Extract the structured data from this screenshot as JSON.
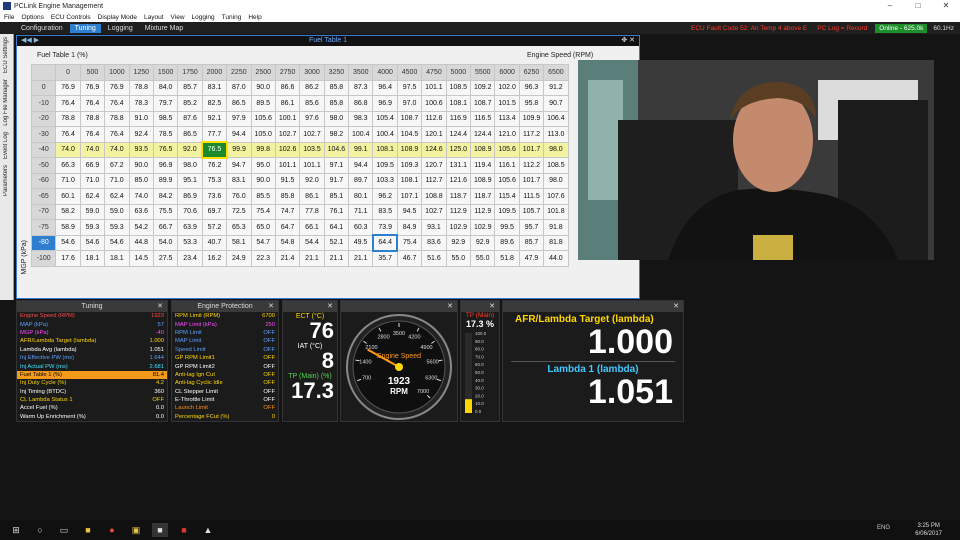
{
  "app": {
    "title": "PCLink Engine Management"
  },
  "menu": [
    "File",
    "Options",
    "ECU Controls",
    "Display Mode",
    "Layout",
    "View",
    "Logging",
    "Tuning",
    "Help"
  ],
  "tabs": [
    "Configuration",
    "Tuning",
    "Logging",
    "Mixture Map"
  ],
  "status": {
    "fault": "ECU Fault Code 52: An Temp 4 above E",
    "log": "PC Log = Record",
    "online": "Online - 625.0k",
    "hz": "60.1Hz"
  },
  "side_tabs": [
    "ECU Settings",
    "Log File Manager",
    "Event Log",
    "Parameters"
  ],
  "fuel": {
    "window_title": "Fuel Table 1",
    "label": "Fuel Table 1 (%)",
    "x_label": "Engine Speed (RPM)",
    "y_label": "MGP (kPa)",
    "rpm": [
      "0",
      "500",
      "1000",
      "1250",
      "1500",
      "1750",
      "2000",
      "2250",
      "2500",
      "2750",
      "3000",
      "3250",
      "3500",
      "4000",
      "4500",
      "4750",
      "5000",
      "5500",
      "6000",
      "6250",
      "6500"
    ],
    "rows": [
      {
        "mgp": "0",
        "v": [
          "76.9",
          "76.9",
          "76.9",
          "78.8",
          "84.0",
          "85.7",
          "83.1",
          "87.0",
          "90.0",
          "86.6",
          "86.2",
          "85.8",
          "87.3",
          "96.4",
          "97.5",
          "101.1",
          "108.5",
          "109.2",
          "102.0",
          "96.3",
          "91.2"
        ]
      },
      {
        "mgp": "-10",
        "v": [
          "76.4",
          "76.4",
          "76.4",
          "78.3",
          "79.7",
          "85.2",
          "82.5",
          "86.5",
          "89.5",
          "86.1",
          "85.6",
          "85.8",
          "86.8",
          "96.9",
          "97.0",
          "100.6",
          "108.1",
          "108.7",
          "101.5",
          "95.8",
          "90.7"
        ]
      },
      {
        "mgp": "-20",
        "v": [
          "78.8",
          "78.8",
          "78.8",
          "91.0",
          "98.5",
          "87.6",
          "92.1",
          "97.9",
          "105.6",
          "100.1",
          "97.6",
          "98.0",
          "98.3",
          "105.4",
          "108.7",
          "112.6",
          "116.9",
          "116.5",
          "113.4",
          "109.9",
          "106.4"
        ]
      },
      {
        "mgp": "-30",
        "v": [
          "76.4",
          "76.4",
          "76.4",
          "92.4",
          "78.5",
          "86.5",
          "77.7",
          "94.4",
          "105.0",
          "102.7",
          "102.7",
          "98.2",
          "100.4",
          "100.4",
          "104.5",
          "120.1",
          "124.4",
          "124.4",
          "121.0",
          "117.2",
          "113.0"
        ]
      },
      {
        "mgp": "-40",
        "v": [
          "74.0",
          "74.0",
          "74.0",
          "93.5",
          "76.5",
          "92.0",
          "76.5",
          "99.9",
          "99.8",
          "102.6",
          "103.5",
          "104.6",
          "99.1",
          "108.1",
          "108.9",
          "124.6",
          "125.0",
          "108.9",
          "105.6",
          "101.7",
          "98.0"
        ]
      },
      {
        "mgp": "-50",
        "v": [
          "66.3",
          "66.9",
          "67.2",
          "90.0",
          "96.9",
          "98.0",
          "76.2",
          "94.7",
          "95.0",
          "101.1",
          "101.1",
          "97.1",
          "94.4",
          "109.5",
          "109.3",
          "120.7",
          "131.1",
          "119.4",
          "116.1",
          "112.2",
          "108.5"
        ]
      },
      {
        "mgp": "-60",
        "v": [
          "71.0",
          "71.0",
          "71.0",
          "85.0",
          "89.9",
          "95.1",
          "75.3",
          "83.1",
          "90.0",
          "91.5",
          "92.0",
          "91.7",
          "89.7",
          "103.3",
          "108.1",
          "112.7",
          "121.6",
          "108.9",
          "105.6",
          "101.7",
          "98.0"
        ]
      },
      {
        "mgp": "-65",
        "v": [
          "60.1",
          "62.4",
          "62.4",
          "74.0",
          "84.2",
          "86.9",
          "73.6",
          "76.0",
          "85.5",
          "85.8",
          "86.1",
          "85.1",
          "80.1",
          "96.2",
          "107.1",
          "108.8",
          "118.7",
          "118.7",
          "115.4",
          "111.5",
          "107.6"
        ]
      },
      {
        "mgp": "-70",
        "v": [
          "58.2",
          "59.0",
          "59.0",
          "63.6",
          "75.5",
          "70.6",
          "69.7",
          "72.5",
          "75.4",
          "74.7",
          "77.8",
          "76.1",
          "71.1",
          "83.5",
          "94.5",
          "102.7",
          "112.9",
          "112.9",
          "109.5",
          "105.7",
          "101.8"
        ]
      },
      {
        "mgp": "-75",
        "v": [
          "58.9",
          "59.3",
          "59.3",
          "54.2",
          "66.7",
          "63.9",
          "57.2",
          "65.3",
          "65.0",
          "64.7",
          "66.1",
          "64.1",
          "60.3",
          "73.9",
          "84.9",
          "93.1",
          "102.9",
          "102.9",
          "99.5",
          "95.7",
          "91.8"
        ]
      },
      {
        "mgp": "-80",
        "v": [
          "54.6",
          "54.6",
          "54.6",
          "44.8",
          "54.0",
          "53.3",
          "40.7",
          "58.1",
          "54.7",
          "54.8",
          "54.4",
          "52.1",
          "49.5",
          "64.4",
          "75.4",
          "83.6",
          "92.9",
          "92.9",
          "89.6",
          "85.7",
          "81.8"
        ]
      },
      {
        "mgp": "-100",
        "v": [
          "17.6",
          "18.1",
          "18.1",
          "14.5",
          "27.5",
          "23.4",
          "16.2",
          "24.9",
          "22.3",
          "21.4",
          "21.1",
          "21.1",
          "21.1",
          "35.7",
          "46.7",
          "51.6",
          "55.0",
          "55.0",
          "51.8",
          "47.9",
          "44.0"
        ]
      }
    ]
  },
  "tuning": {
    "title": "Tuning",
    "rows": [
      {
        "l": "Engine Speed (RPM)",
        "v": "1923",
        "c": "#ff4a4a"
      },
      {
        "l": "MAP (kPa)",
        "v": "57",
        "c": "#5aa0ff"
      },
      {
        "l": "MGP (kPa)",
        "v": "-40",
        "c": "#ff4aff"
      },
      {
        "l": "AFR/Lambda Target (lambda)",
        "v": "1.000",
        "c": "#ffd700"
      },
      {
        "l": "Lambda Avg (lambda)",
        "v": "1.051",
        "c": "#ffffff"
      },
      {
        "l": "Inj Effective PW (ms)",
        "v": "1.644",
        "c": "#5aa0ff"
      },
      {
        "l": "Inj Actual PW (ms)",
        "v": "2.681",
        "c": "#40e0ff"
      },
      {
        "l": "Fuel Table 1 (%)",
        "v": "81.4",
        "c": "#000000"
      },
      {
        "l": "Inj Duty Cycle (%)",
        "v": "4.2",
        "c": "#ffd700"
      },
      {
        "l": "Inj Timing (BTDC)",
        "v": "360",
        "c": "#ffffff"
      },
      {
        "l": "CL Lambda Status 1",
        "v": "OFF",
        "c": "#ffd700"
      },
      {
        "l": "Accel Fuel (%)",
        "v": "0.0",
        "c": "#ffffff"
      },
      {
        "l": "Warm Up Enrichment (%)",
        "v": "0.0",
        "c": "#ffffff"
      }
    ]
  },
  "protect": {
    "title": "Engine Protection",
    "rows": [
      {
        "l": "RPM Limit (RPM)",
        "v": "6700",
        "c": "#ffd700"
      },
      {
        "l": "MAP Limit (kPa)",
        "v": "250",
        "c": "#ff4aff"
      },
      {
        "l": "RPM Limit",
        "v": "OFF",
        "c": "#5aa0ff"
      },
      {
        "l": "MAP Limit",
        "v": "OFF",
        "c": "#5aa0ff"
      },
      {
        "l": "Speed Limit",
        "v": "OFF",
        "c": "#5aa0ff"
      },
      {
        "l": "GP RPM Limit1",
        "v": "OFF",
        "c": "#ffd700"
      },
      {
        "l": "GP RPM Limit2",
        "v": "OFF",
        "c": "#ffffff"
      },
      {
        "l": "Anti-lag Ign Cut",
        "v": "OFF",
        "c": "#ffd700"
      },
      {
        "l": "Anti-lag Cyclic Idle",
        "v": "OFF",
        "c": "#ffd700"
      },
      {
        "l": "CL Stepper Limit",
        "v": "OFF",
        "c": "#ffffff"
      },
      {
        "l": "E-Throttle Limit",
        "v": "OFF",
        "c": "#ffffff"
      },
      {
        "l": "Launch Limit",
        "v": "OFF",
        "c": "#ff8c1a"
      },
      {
        "l": "Percentage FCut (%)",
        "v": "0",
        "c": "#ffd700"
      }
    ]
  },
  "gauges": {
    "ect_label": "ECT (°C)",
    "ect": "76",
    "iat_label": "IAT (°C)",
    "iat": "8",
    "tp_label": "TP (Main) (%)",
    "tp": "17.3",
    "rpm_title": "Engine Speed",
    "rpm": "1923",
    "rpm_unit": "RPM",
    "rpm_ticks": [
      "700",
      "1400",
      "2100",
      "2800",
      "3500",
      "4200",
      "4900",
      "5600",
      "6300",
      "7000"
    ],
    "tp_bar_title": "TP (Main)",
    "tp_bar_val": "17.3 %",
    "tp_fraction": 0.173,
    "tp_bar_ticks": [
      "100.0",
      "90.0",
      "80.0",
      "70.0",
      "60.0",
      "50.0",
      "40.0",
      "30.0",
      "20.0",
      "10.0",
      "0.0"
    ],
    "afr_title": "AFR/Lambda Target (lambda)",
    "afr": "1.000",
    "lam_title": "Lambda 1 (lambda)",
    "lam": "1.051"
  },
  "taskbar": {
    "time": "3:25 PM",
    "date": "6/06/2017",
    "lang": "ENG"
  }
}
